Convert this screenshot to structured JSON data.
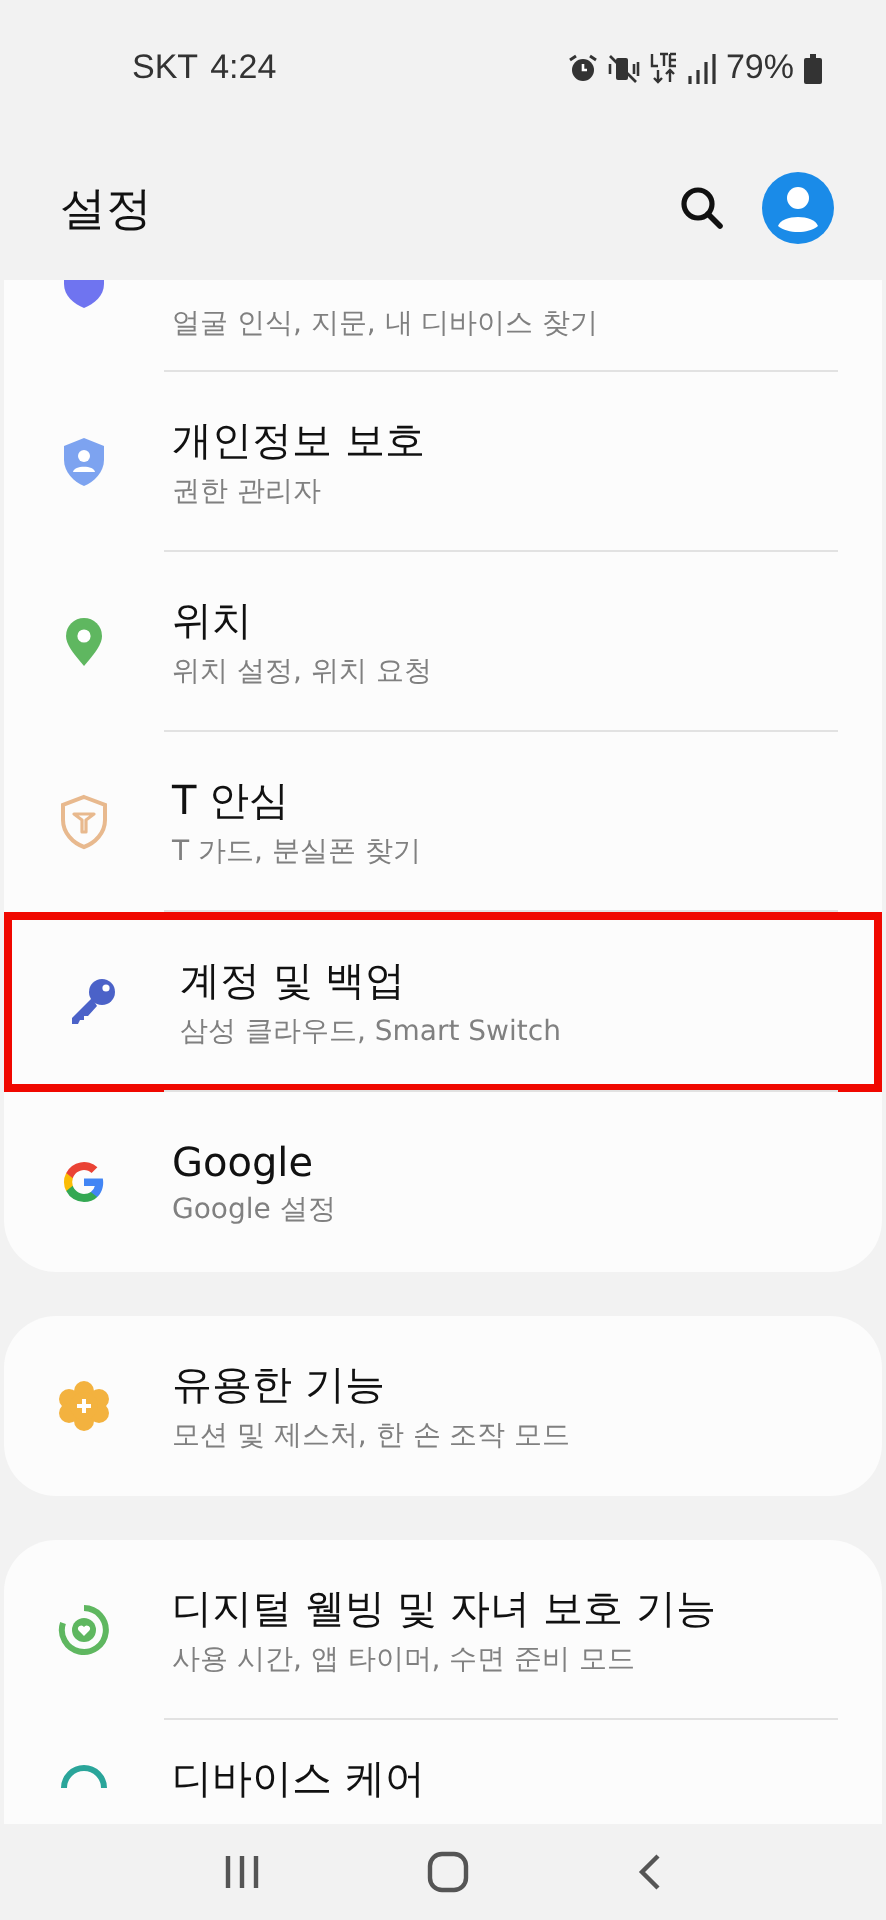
{
  "status_bar": {
    "carrier": "SKT",
    "time": "4:24",
    "battery": "79%"
  },
  "header": {
    "title": "설정"
  },
  "groups": [
    {
      "items": [
        {
          "subtitle": "얼굴 인식, 지문, 내 디바이스 찾기",
          "highlighted": false
        },
        {
          "title": "개인정보 보호",
          "subtitle": "권한 관리자",
          "highlighted": false
        },
        {
          "title": "위치",
          "subtitle": "위치 설정, 위치 요청",
          "highlighted": false
        },
        {
          "title": "T 안심",
          "subtitle": "T 가드, 분실폰 찾기",
          "highlighted": false
        },
        {
          "title": "계정 및 백업",
          "subtitle": "삼성 클라우드, Smart Switch",
          "highlighted": true
        },
        {
          "title": "Google",
          "subtitle": "Google 설정",
          "highlighted": false
        }
      ]
    },
    {
      "items": [
        {
          "title": "유용한 기능",
          "subtitle": "모션 및 제스처, 한 손 조작 모드",
          "highlighted": false
        }
      ]
    },
    {
      "items": [
        {
          "title": "디지털 웰빙 및 자녀 보호 기능",
          "subtitle": "사용 시간, 앱 타이머, 수면 준비 모드",
          "highlighted": false
        },
        {
          "title": "디바이스 케어",
          "highlighted": false
        }
      ]
    }
  ]
}
